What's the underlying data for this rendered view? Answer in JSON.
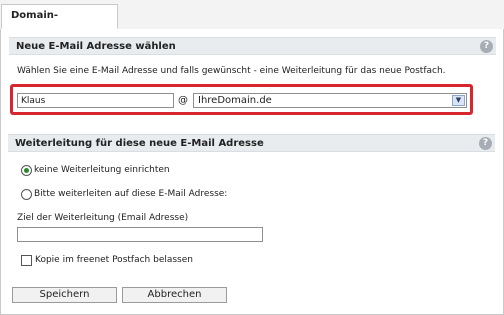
{
  "tab": {
    "label": "Domain-Postfächer"
  },
  "section1": {
    "title": "Neue E-Mail Adresse wählen",
    "description": "Wählen Sie eine E-Mail Adresse und falls gewünscht - eine Weiterleitung für das neue Postfach.",
    "local_part_value": "Klaus",
    "at_sign": "@",
    "domain_selected": "IhreDomain.de",
    "help": "?"
  },
  "section2": {
    "title": "Weiterleitung für diese neue E-Mail Adresse",
    "help": "?",
    "radio_no_forward": "keine Weiterleitung einrichten",
    "radio_forward": "Bitte weiterleiten auf diese E-Mail Adresse:",
    "target_label": "Ziel der Weiterleitung (Email Adresse)",
    "target_value": "",
    "keep_copy_label": "Kopie im freenet Postfach belassen"
  },
  "buttons": {
    "save": "Speichern",
    "cancel": "Abbrechen"
  },
  "colors": {
    "highlight": "#d7262e",
    "section_bg": "#e9ecef",
    "radio_dot": "#2a8a2a"
  }
}
